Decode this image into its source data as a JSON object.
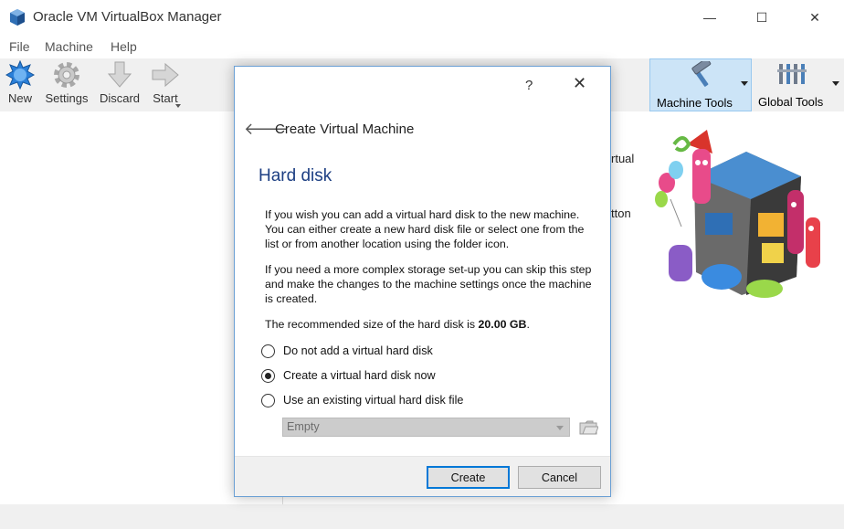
{
  "window": {
    "title": "Oracle VM VirtualBox Manager",
    "minimize": "—",
    "maximize": "☐",
    "close": "✕"
  },
  "menu": {
    "items": [
      "File",
      "Machine",
      "Help"
    ]
  },
  "toolbar": {
    "buttons": [
      {
        "label": "New",
        "icon": "new-vm-icon"
      },
      {
        "label": "Settings",
        "icon": "gear-icon"
      },
      {
        "label": "Discard",
        "icon": "discard-arrow-icon"
      },
      {
        "label": "Start",
        "icon": "start-arrow-icon"
      }
    ],
    "machine_tools": "Machine Tools",
    "global_tools": "Global Tools"
  },
  "background": {
    "fragment_1": "rtual",
    "fragment_2": "tton"
  },
  "dialog": {
    "help": "?",
    "close": "✕",
    "back": "🡐",
    "heading": "Create Virtual Machine",
    "page_title": "Hard disk",
    "paragraph_1": "If you wish you can add a virtual hard disk to the new machine. You can either create a new hard disk file or select one from the list or from another location using the folder icon.",
    "paragraph_2": "If you need a more complex storage set-up you can skip this step and make the changes to the machine settings once the machine is created.",
    "recommended_prefix": "The recommended size of the hard disk is ",
    "recommended_size": "20.00 GB",
    "recommended_suffix": ".",
    "options": [
      {
        "label": "Do not add a virtual hard disk",
        "checked": false
      },
      {
        "label": "Create a virtual hard disk now",
        "checked": true
      },
      {
        "label": "Use an existing virtual hard disk file",
        "checked": false
      }
    ],
    "existing_disk_value": "Empty",
    "create_button": "Create",
    "cancel_button": "Cancel"
  },
  "colors": {
    "accent": "#0078d7",
    "page_title": "#1d3f83",
    "tools_active_bg": "#cce4f7"
  }
}
